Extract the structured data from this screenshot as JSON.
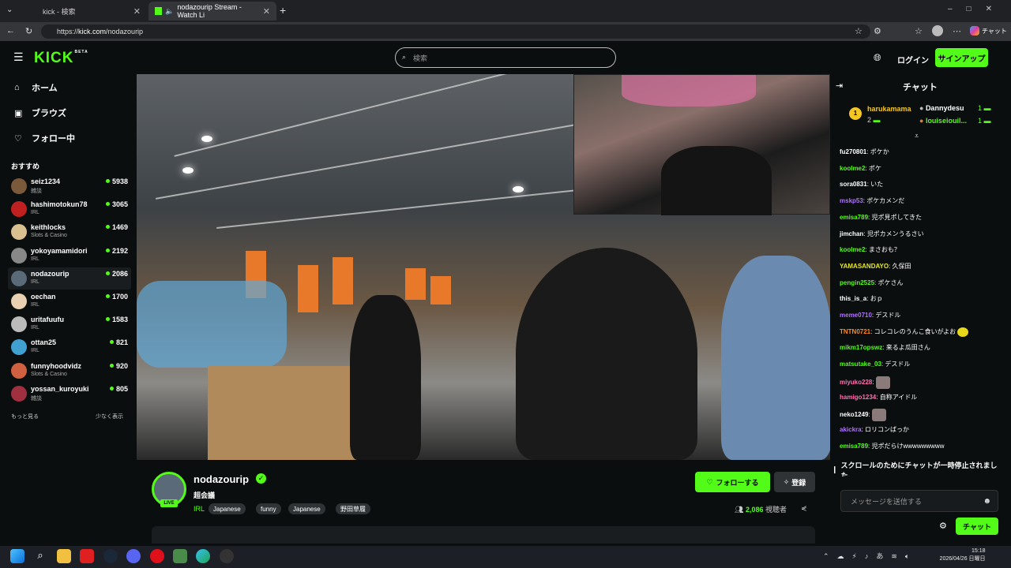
{
  "browser": {
    "tabs": [
      {
        "label": "kick - 検索",
        "active": false
      },
      {
        "label": "nodazourip Stream - Watch Li",
        "active": true
      }
    ],
    "url_prefix": "https://",
    "url_host": "kick.com",
    "url_path": "/nodazourip",
    "chat_btn": "チャット"
  },
  "header": {
    "logo": "KICK",
    "logo_badge": "BETA",
    "search_placeholder": "検索",
    "login": "ログイン",
    "signup": "サインアップ"
  },
  "sidebar": {
    "nav": [
      {
        "label": "ホーム",
        "icon": "home-icon"
      },
      {
        "label": "ブラウズ",
        "icon": "browse-icon"
      },
      {
        "label": "フォロー中",
        "icon": "heart-icon"
      }
    ],
    "recommended_title": "おすすめ",
    "channels": [
      {
        "name": "seiz1234",
        "category": "雑談",
        "viewers": "5938",
        "color": "#7a5a3a"
      },
      {
        "name": "hashimotokun78",
        "category": "IRL",
        "viewers": "3065",
        "color": "#c02020"
      },
      {
        "name": "keithlocks",
        "category": "Slots & Casino",
        "viewers": "1469",
        "color": "#d8c090"
      },
      {
        "name": "yokoyamamidori",
        "category": "IRL",
        "viewers": "2192",
        "color": "#888"
      },
      {
        "name": "nodazourip",
        "category": "IRL",
        "viewers": "2086",
        "color": "#5a6a78"
      },
      {
        "name": "oechan",
        "category": "IRL",
        "viewers": "1700",
        "color": "#e8d0b0"
      },
      {
        "name": "uritafuufu",
        "category": "IRL",
        "viewers": "1583",
        "color": "#bbb"
      },
      {
        "name": "ottan25",
        "category": "IRL",
        "viewers": "821",
        "color": "#40a0d0"
      },
      {
        "name": "funnyhoodvidz",
        "category": "Slots & Casino",
        "viewers": "920",
        "color": "#d06040"
      },
      {
        "name": "yossan_kuroyuki",
        "category": "雑談",
        "viewers": "805",
        "color": "#a03040"
      }
    ],
    "show_more": "もっと見る",
    "show_less": "少なく表示"
  },
  "stream": {
    "live_badge": "LIVE",
    "streamer": "nodazourip",
    "title": "超会議",
    "category": "IRL",
    "tags": [
      "Japanese",
      "funny",
      "Japanese",
      "野田草履"
    ],
    "follow": "フォローする",
    "subscribe": "登録",
    "viewers": "2,086",
    "viewers_label": "視聴者"
  },
  "chat": {
    "title": "チャット",
    "pinned": [
      {
        "user": "harukamama",
        "count": "2",
        "rank": "1"
      },
      {
        "user": "Dannydesu",
        "count": "1"
      },
      {
        "user": "louiseiouil...",
        "count": "1"
      }
    ],
    "messages": [
      {
        "user": "fu270801",
        "text": "ポケか",
        "color": "#ffffff"
      },
      {
        "user": "koolme2",
        "text": "ポケ",
        "color": "#53fc18"
      },
      {
        "user": "sora0831",
        "text": "いた",
        "color": "#ffffff"
      },
      {
        "user": "mskp53",
        "text": "ポケカメンだ",
        "color": "#b070ff"
      },
      {
        "user": "emisa789",
        "text": "児ポ見ポしてきた",
        "color": "#53fc18"
      },
      {
        "user": "jimchan",
        "text": "児ポカメンうるさい",
        "color": "#ffffff"
      },
      {
        "user": "koolme2",
        "text": "まさおも？",
        "color": "#53fc18"
      },
      {
        "user": "YAMASANDAYO",
        "text": "久保田",
        "color": "#e8e81c"
      },
      {
        "user": "pengin2525",
        "text": "ポケさん",
        "color": "#53fc18"
      },
      {
        "user": "this_is_a",
        "text": "おｐ",
        "color": "#ffffff"
      },
      {
        "user": "meme0710",
        "text": "デスドル",
        "color": "#b070ff"
      },
      {
        "user": "TNTN0721",
        "text": "コレコレのうんこ食いがよお",
        "color": "#ff8c1a"
      },
      {
        "user": "mikm17opswz",
        "text": "来るよ瓜田さん",
        "color": "#53fc18"
      },
      {
        "user": "matsutake_03",
        "text": "デスドル",
        "color": "#53fc18"
      },
      {
        "user": "miyuko228",
        "text": "",
        "color": "#ff6fb0"
      },
      {
        "user": "hamigo1234",
        "text": "自称アイドル",
        "color": "#ff6fb0"
      },
      {
        "user": "neko1249",
        "text": "",
        "color": "#ffffff"
      },
      {
        "user": "akickra",
        "text": "ロリコンばっか",
        "color": "#b070ff"
      },
      {
        "user": "emisa789",
        "text": "児ポだらけwwwwwwwww",
        "color": "#53fc18"
      }
    ],
    "paused": "スクロールのためにチャットが一時停止されました。",
    "input_placeholder": "メッセージを送信する",
    "send": "チャット"
  },
  "taskbar": {
    "time": "15:18",
    "date": "2026/04/26 日曜日"
  }
}
